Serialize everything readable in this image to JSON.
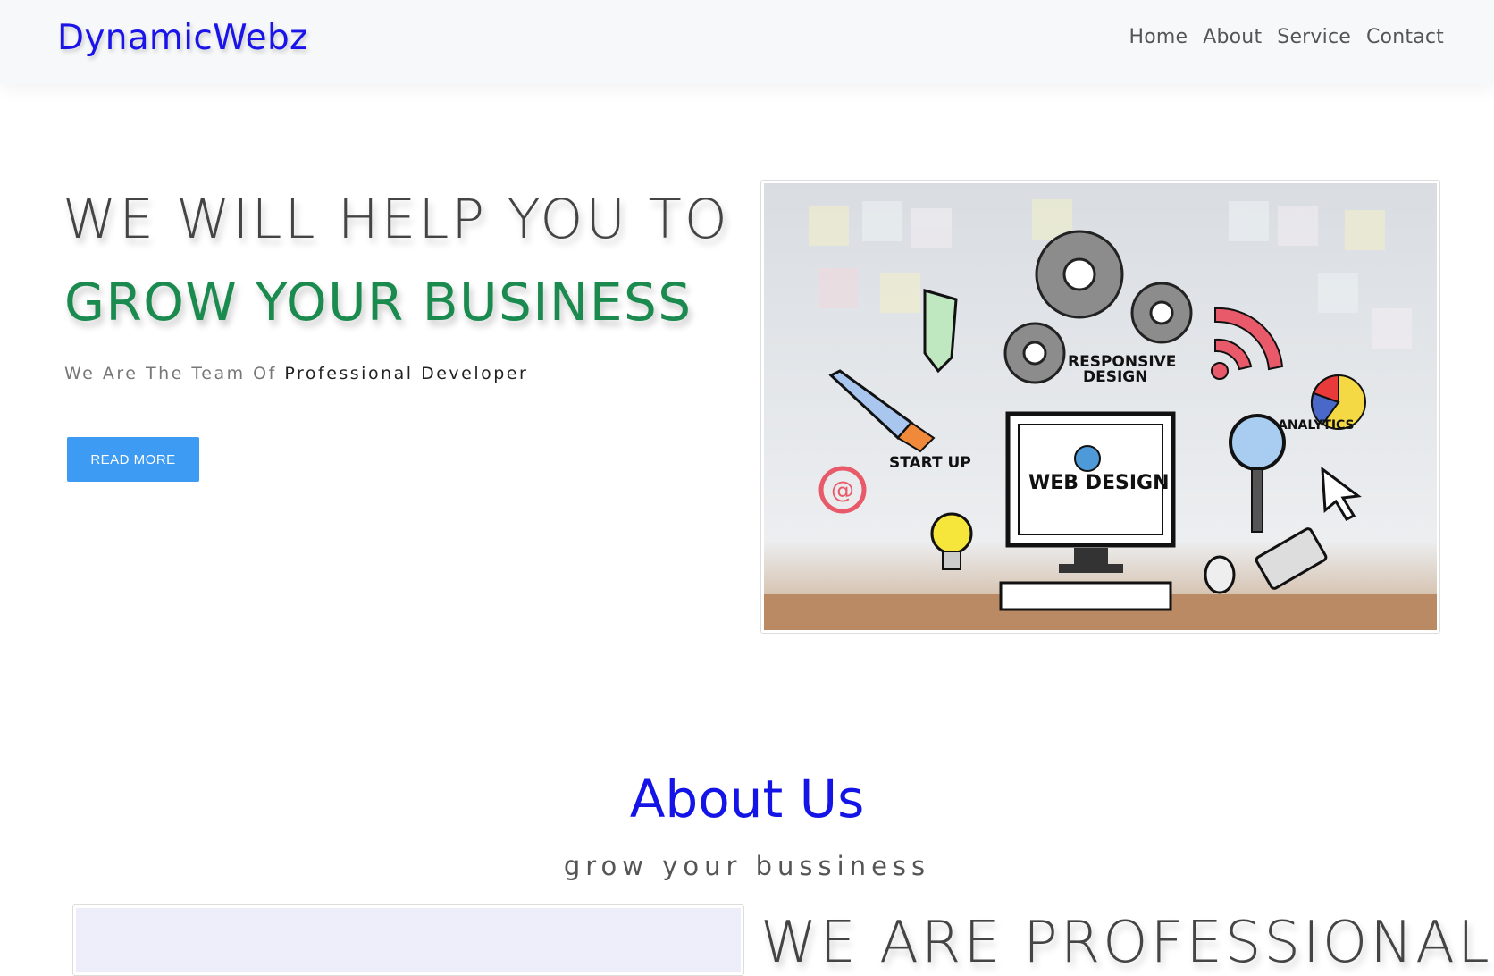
{
  "navbar": {
    "brand": "DynamicWebz",
    "links": [
      "Home",
      "About",
      "Service",
      "Contact"
    ]
  },
  "hero": {
    "heading_line1": "WE WILL HELP YOU TO",
    "heading_line2": "GROW YOUR BUSINESS",
    "tagline_prefix": "We Are The Team Of",
    "tagline_emphasis": "Professional Developer",
    "button_label": "READ MORE",
    "illustration": {
      "labels": [
        "RESPONSIVE",
        "DESIGN",
        "ANALYTICS",
        "START UP",
        "WEB DESIGN",
        "@"
      ]
    }
  },
  "about": {
    "title": "About Us",
    "subtitle": "grow your bussiness",
    "heading": "WE ARE PROFESSIONAL"
  },
  "colors": {
    "brand": "#1a14e8",
    "accent_green": "#1a8a4f",
    "button": "#3d9bf4",
    "about_title": "#1414e6"
  }
}
